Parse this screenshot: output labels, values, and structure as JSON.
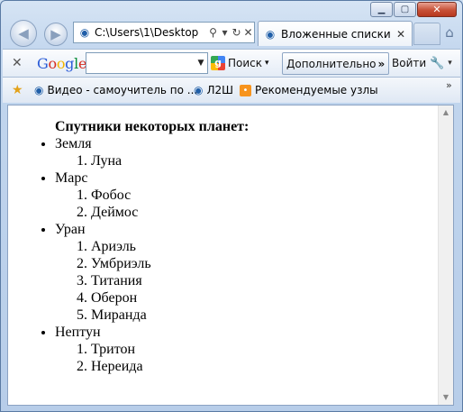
{
  "window": {
    "caption": {
      "minimize": "▁",
      "maximize": "▢",
      "close": "✕"
    }
  },
  "nav": {
    "address": "C:\\Users\\1\\Desktop",
    "tab_title": "Вложенные списки"
  },
  "google_toolbar": {
    "logo": [
      "G",
      "o",
      "o",
      "g",
      "l",
      "e"
    ],
    "search_placeholder": "",
    "search_label": "Поиск",
    "more_label": "Дополнительно",
    "signin_label": "Войти"
  },
  "favorites": {
    "items": [
      {
        "label": "Видео - самоучитель по ...",
        "icon": "ie-page-icon"
      },
      {
        "label": "Л2Ш",
        "icon": "ie-page-icon"
      },
      {
        "label": "Рекомендуемые узлы",
        "icon": "rss-feed-icon"
      }
    ]
  },
  "page": {
    "title": "Спутники некоторых планет:",
    "planets": [
      {
        "name": "Земля",
        "moons": [
          "Луна"
        ]
      },
      {
        "name": "Марс",
        "moons": [
          "Фобос",
          "Деймос"
        ]
      },
      {
        "name": "Уран",
        "moons": [
          "Ариэль",
          "Умбриэль",
          "Титания",
          "Оберон",
          "Миранда"
        ]
      },
      {
        "name": "Нептун",
        "moons": [
          "Тритон",
          "Нереида"
        ]
      }
    ]
  }
}
